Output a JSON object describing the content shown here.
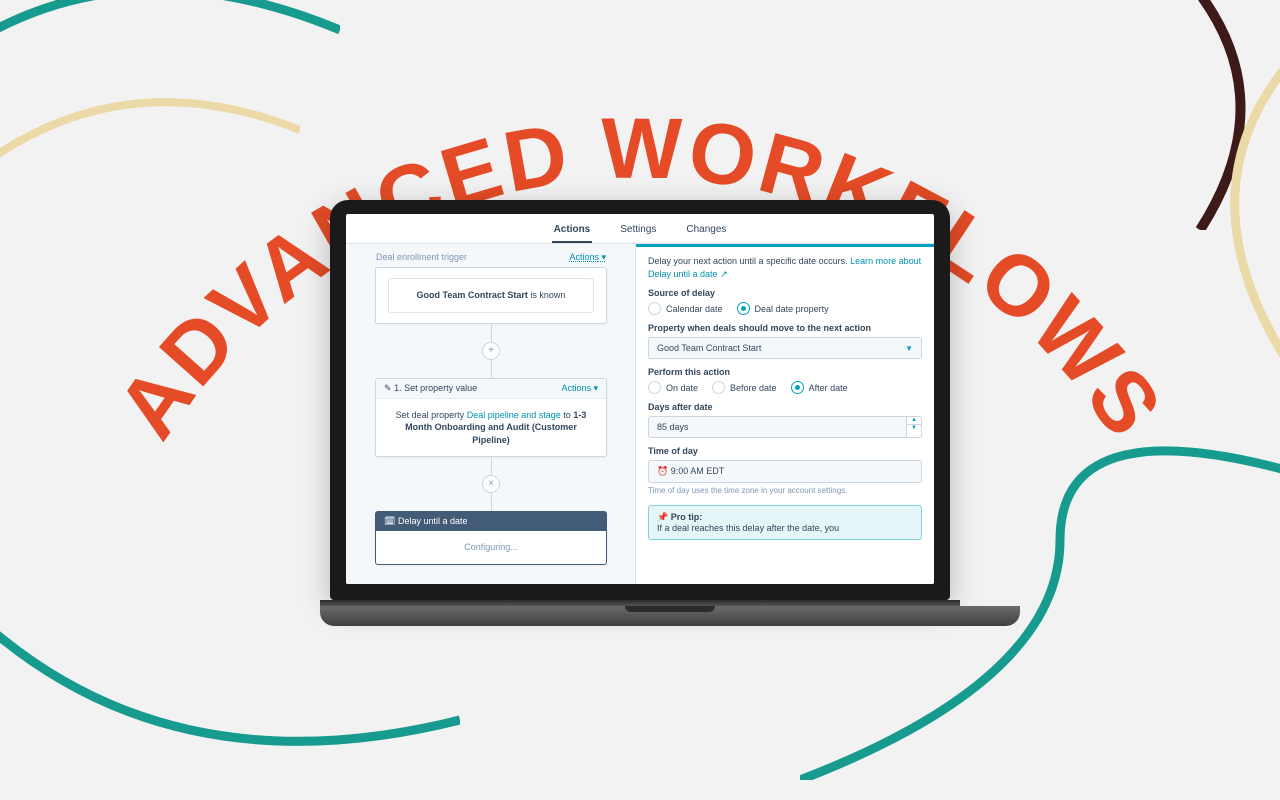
{
  "headline": "ADVANCED WORKFLOWS",
  "tabs": [
    "Actions",
    "Settings",
    "Changes"
  ],
  "active_tab": 0,
  "flow": {
    "trigger_hd": "Deal enrollment trigger",
    "trigger_actions": "Actions",
    "trigger_prop": "Good Team Contract Start",
    "trigger_cond": "is known",
    "step1_hd": "1. Set property value",
    "step1_actions": "Actions",
    "step1_pre": "Set deal property",
    "step1_prop": "Deal pipeline and stage",
    "step1_to": "to",
    "step1_val": "1-3 Month Onboarding and Audit (Customer Pipeline)",
    "step2_hd": "Delay until a date",
    "step2_body": "Configuring..."
  },
  "panel": {
    "intro_a": "Delay your next action until a specific date occurs.",
    "intro_link": "Learn more about Delay until a date",
    "src_lbl": "Source of delay",
    "src_opts": [
      "Calendar date",
      "Deal date property"
    ],
    "src_sel": 1,
    "prop_lbl": "Property when deals should move to the next action",
    "prop_val": "Good Team Contract Start",
    "perf_lbl": "Perform this action",
    "perf_opts": [
      "On date",
      "Before date",
      "After date"
    ],
    "perf_sel": 2,
    "days_lbl": "Days after date",
    "days_val": "85 days",
    "tod_lbl": "Time of day",
    "tod_val": "9:00 AM EDT",
    "tod_hint": "Time of day uses the time zone in your account settings.",
    "tip_hd": "Pro tip:",
    "tip_body": "If a deal reaches this delay after the date, you"
  }
}
